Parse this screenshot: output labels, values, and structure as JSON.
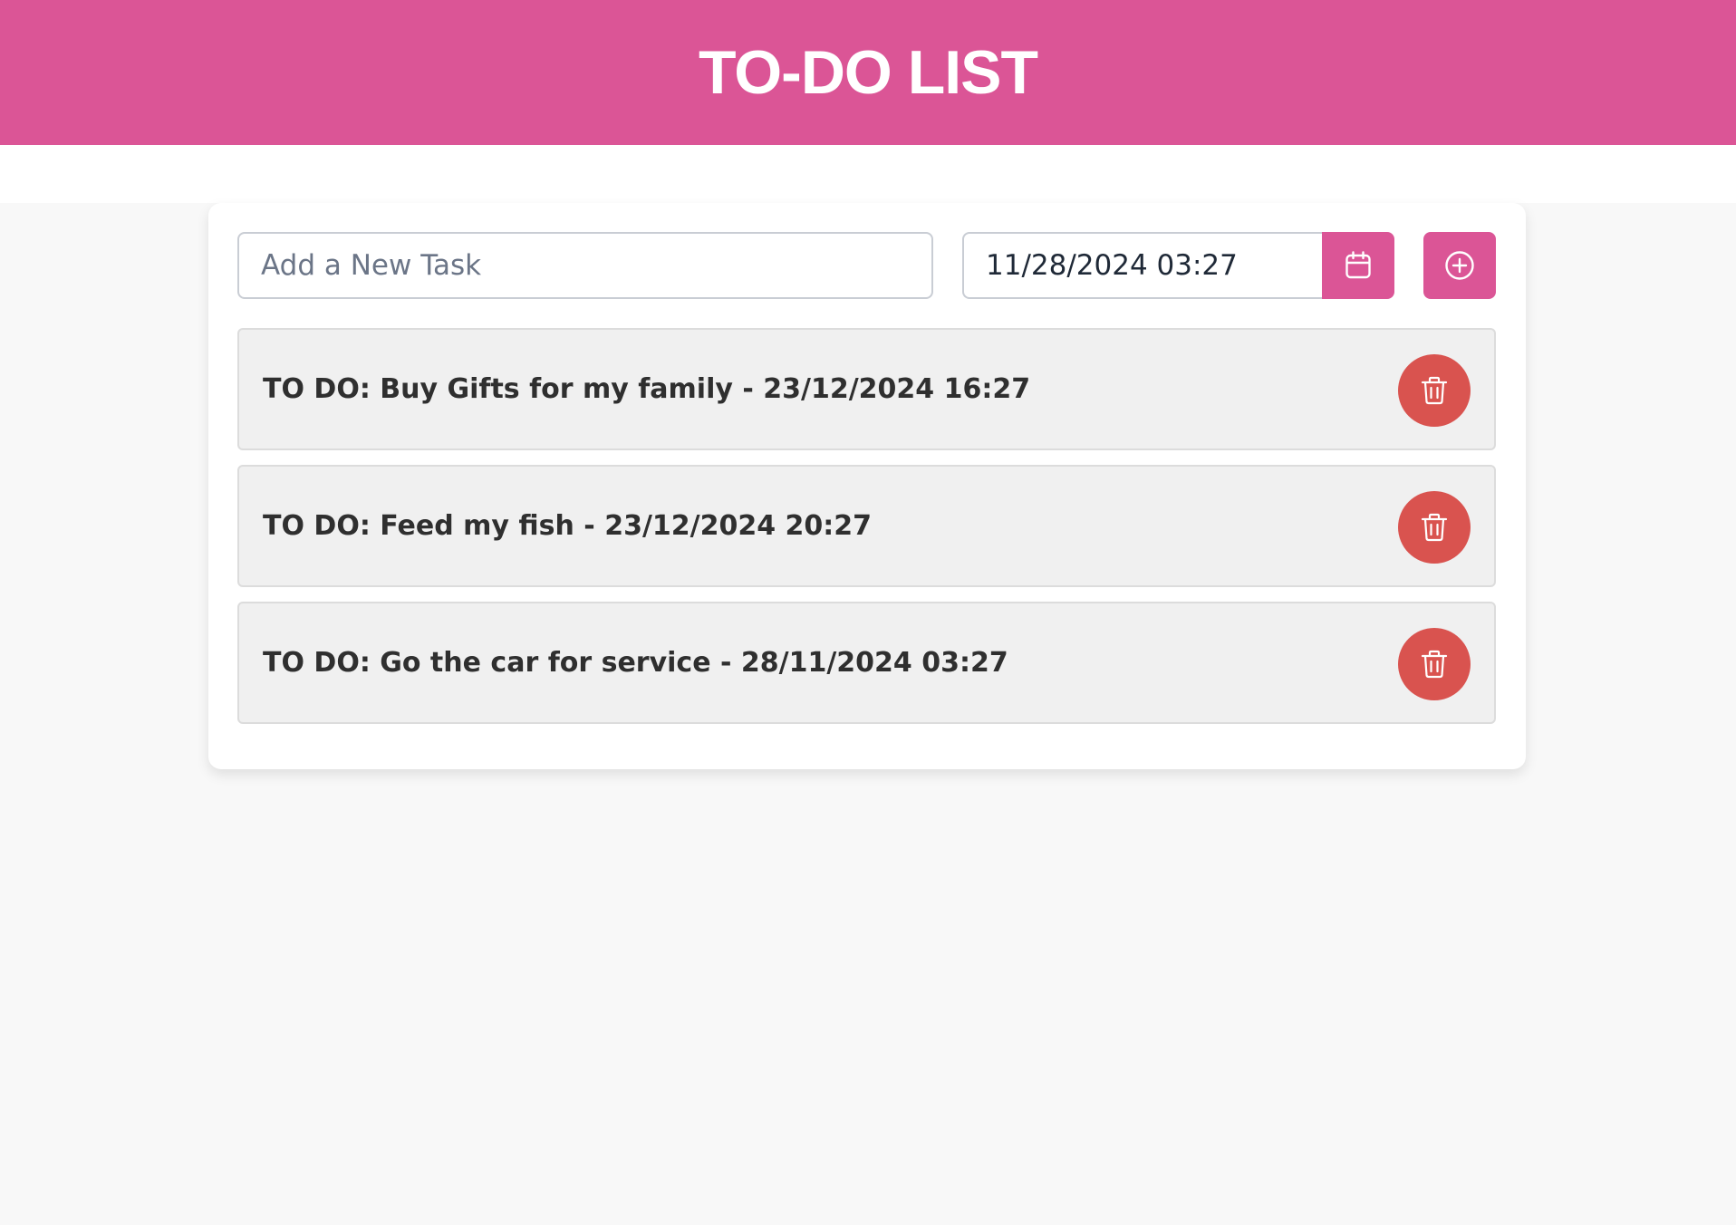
{
  "header": {
    "title": "TO-DO LIST"
  },
  "form": {
    "task_placeholder": "Add a New Task",
    "task_value": "",
    "date_value": "11/28/2024 03:27"
  },
  "tasks": [
    {
      "text": "TO DO: Buy Gifts for my family - 23/12/2024 16:27"
    },
    {
      "text": "TO DO: Feed my fish - 23/12/2024 20:27"
    },
    {
      "text": "TO DO: Go the car for service - 28/11/2024 03:27"
    }
  ],
  "icons": {
    "calendar": "calendar-icon",
    "add": "plus-circle-icon",
    "delete": "trash-icon"
  },
  "colors": {
    "brand": "#db5596",
    "danger": "#d9534f",
    "task_bg": "#f0f0f0"
  }
}
